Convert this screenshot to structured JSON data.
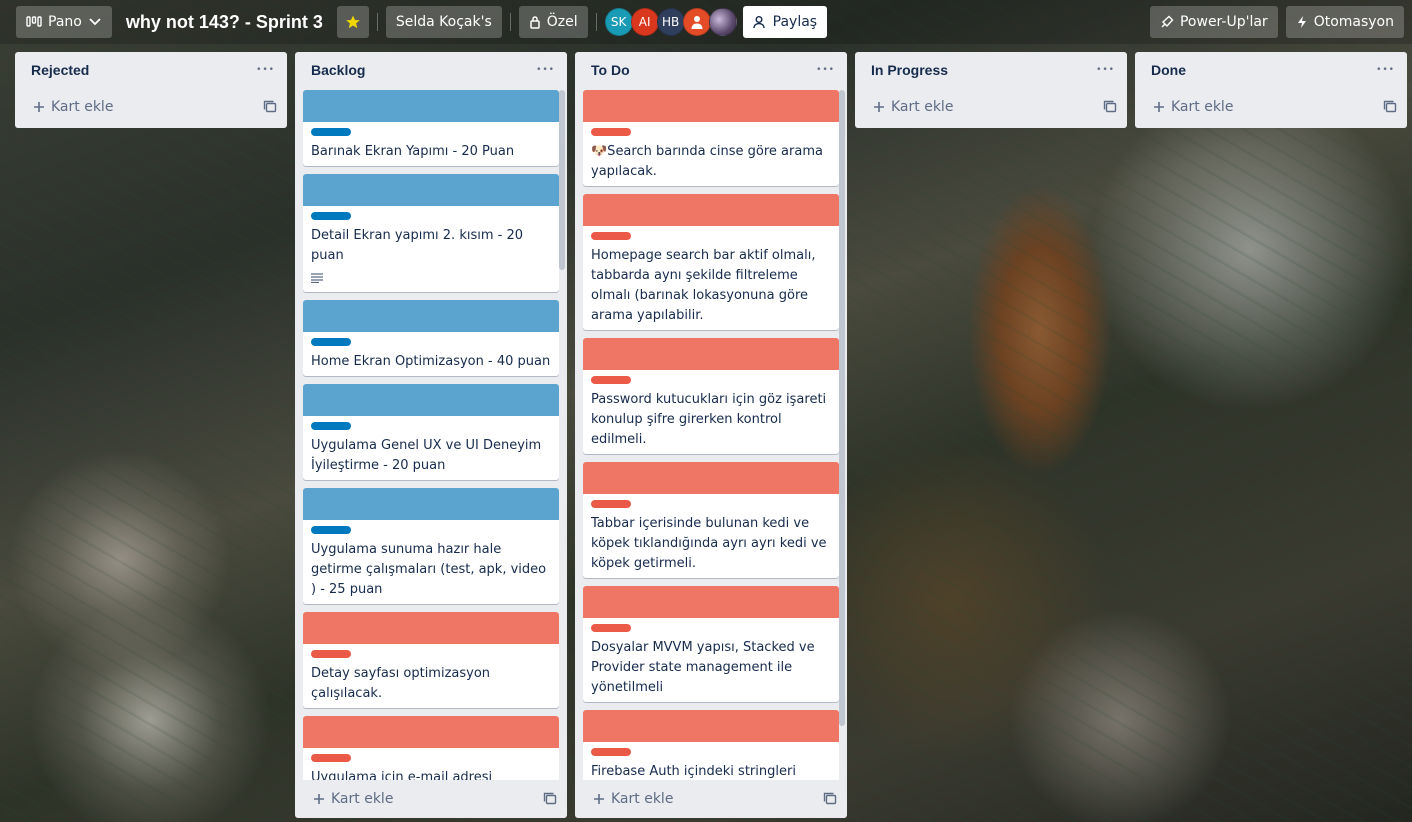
{
  "colors": {
    "blue_cover": "#5ba4cf",
    "blue_label": "#0079bf",
    "red_cover": "#ef7564",
    "red_label": "#eb5a46"
  },
  "header": {
    "board_switcher": "Pano",
    "board_title": "why not 143? - Sprint 3",
    "workspace": "Selda Koçak's",
    "visibility": "Özel",
    "share": "Paylaş",
    "powerups": "Power-Up'lar",
    "automation": "Otomasyon",
    "members": [
      {
        "initials": "SK",
        "color": "#1a9bb5"
      },
      {
        "initials": "AI",
        "color": "#d9381e"
      },
      {
        "initials": "HB",
        "color": "#2f3e5c"
      },
      {
        "initials": "",
        "color": "#e34c26",
        "icon": "person-icon"
      },
      {
        "initials": "",
        "color": "#5c4a6e",
        "icon": "photo-avatar"
      }
    ]
  },
  "add_card_label": "Kart ekle",
  "lists": [
    {
      "title": "Rejected",
      "cards": []
    },
    {
      "title": "Backlog",
      "cards": [
        {
          "cover": "blue",
          "title": "Barınak Ekran Yapımı - 20 Puan"
        },
        {
          "cover": "blue",
          "title": "Detail Ekran yapımı 2. kısım - 20 puan",
          "has_description": true
        },
        {
          "cover": "blue",
          "title": "Home Ekran Optimizasyon - 40 puan"
        },
        {
          "cover": "blue",
          "title": "Uygulama Genel UX ve UI Deneyim İyileştirme - 20 puan"
        },
        {
          "cover": "blue",
          "title": "Uygulama sunuma hazır hale getirme çalışmaları (test, apk, video ) - 25 puan"
        },
        {
          "cover": "red",
          "title": "Detay sayfası optimizasyon çalışılacak."
        },
        {
          "cover": "red",
          "title": "Uygulama için e-mail adresi"
        }
      ]
    },
    {
      "title": "To Do",
      "cards": [
        {
          "cover": "red",
          "title": "🐶Search barında cinse göre arama yapılacak."
        },
        {
          "cover": "red",
          "title": "Homepage search bar aktif olmalı, tabbarda aynı şekilde filtreleme olmalı (barınak lokasyonuna göre arama yapılabilir."
        },
        {
          "cover": "red",
          "title": "Password kutucukları için göz işareti konulup şifre girerken kontrol edilmeli."
        },
        {
          "cover": "red",
          "title": "Tabbar içerisinde bulunan kedi ve köpek tıklandığında ayrı ayrı kedi ve köpek getirmeli."
        },
        {
          "cover": "red",
          "title": "Dosyalar MVVM yapısı, Stacked ve Provider state management ile yönetilmeli"
        },
        {
          "cover": "red",
          "title": "Firebase Auth içindeki stringleri belki"
        }
      ]
    },
    {
      "title": "In Progress",
      "cards": []
    },
    {
      "title": "Done",
      "cards": []
    }
  ]
}
